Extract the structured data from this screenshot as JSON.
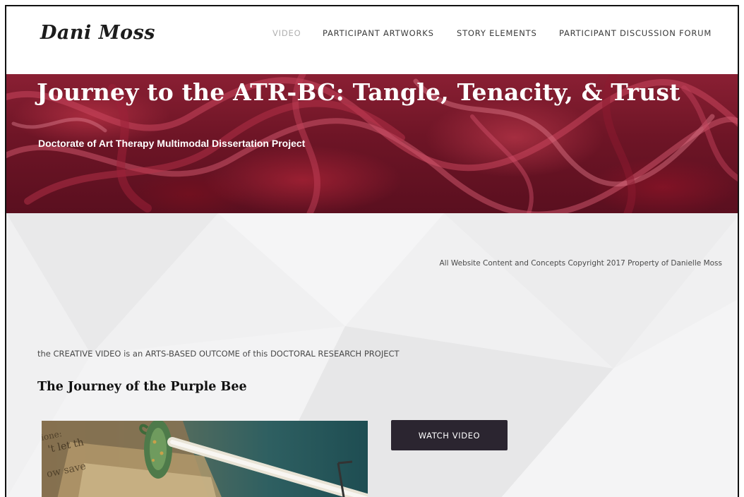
{
  "header": {
    "logo": "Dani Moss",
    "nav": [
      {
        "label": "VIDEO",
        "active": true
      },
      {
        "label": "PARTICIPANT ARTWORKS",
        "active": false
      },
      {
        "label": "STORY ELEMENTS",
        "active": false
      },
      {
        "label": "PARTICIPANT DISCUSSION FORUM",
        "active": false
      }
    ]
  },
  "hero": {
    "title": "Journey to the ATR-BC: Tangle, Tenacity, & Trust",
    "subtitle": "Doctorate of Art Therapy Multimodal Dissertation Project"
  },
  "main": {
    "copyright": "All Website Content and Concepts Copyright 2017 Property of Danielle Moss",
    "intro": "the CREATIVE VIDEO is an ARTS-BASED OUTCOME of this DOCTORAL RESEARCH PROJECT",
    "video_title": "The Journey of the Purple Bee",
    "watch_button": "WATCH VIDEO"
  },
  "colors": {
    "hero_red": "#7a1a2e",
    "button_bg": "#2b2530",
    "page_bg": "#f0f0f1",
    "nav_active": "#b0b0b0"
  }
}
